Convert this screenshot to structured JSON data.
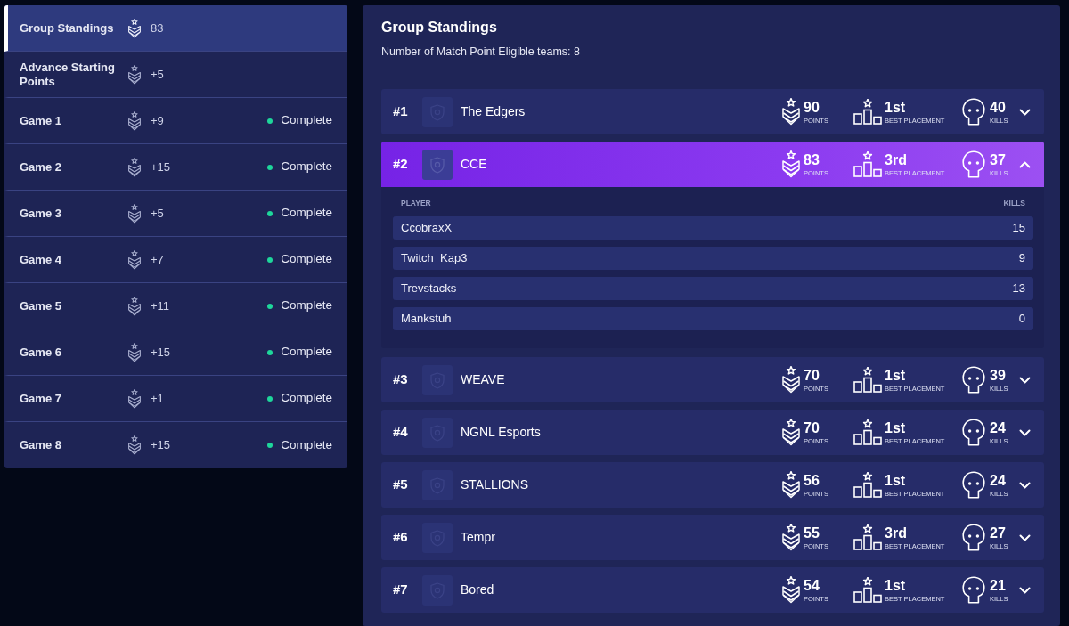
{
  "sidebar": {
    "items": [
      {
        "label": "Group Standings",
        "points": "83",
        "selected": true
      },
      {
        "label": "Advance Starting Points",
        "points": "+5",
        "selected": false
      },
      {
        "label": "Game 1",
        "points": "+9",
        "status": "Complete",
        "selected": false
      },
      {
        "label": "Game 2",
        "points": "+15",
        "status": "Complete",
        "selected": false
      },
      {
        "label": "Game 3",
        "points": "+5",
        "status": "Complete",
        "selected": false
      },
      {
        "label": "Game 4",
        "points": "+7",
        "status": "Complete",
        "selected": false
      },
      {
        "label": "Game 5",
        "points": "+11",
        "status": "Complete",
        "selected": false
      },
      {
        "label": "Game 6",
        "points": "+15",
        "status": "Complete",
        "selected": false
      },
      {
        "label": "Game 7",
        "points": "+1",
        "status": "Complete",
        "selected": false
      },
      {
        "label": "Game 8",
        "points": "+15",
        "status": "Complete",
        "selected": false
      }
    ]
  },
  "standings": {
    "title": "Group Standings",
    "subtitle": "Number of Match Point Eligible teams: 8",
    "teams": [
      {
        "rank": "#1",
        "name": "The Edgers",
        "points": "90",
        "points_label": "POINTS",
        "placement": "1st",
        "placement_label": "BEST PLACEMENT",
        "kills": "40",
        "kills_label": "KILLS",
        "expanded": false
      },
      {
        "rank": "#2",
        "name": "CCE",
        "points": "83",
        "points_label": "POINTS",
        "placement": "3rd",
        "placement_label": "BEST PLACEMENT",
        "kills": "37",
        "kills_label": "KILLS",
        "expanded": true,
        "player_header": "PLAYER",
        "kills_header": "KILLS",
        "players": [
          {
            "name": "CcobraxX",
            "kills": "15"
          },
          {
            "name": "Twitch_Kap3",
            "kills": "9"
          },
          {
            "name": "Trevstacks",
            "kills": "13"
          },
          {
            "name": "Mankstuh",
            "kills": "0"
          }
        ]
      },
      {
        "rank": "#3",
        "name": "WEAVE",
        "points": "70",
        "points_label": "POINTS",
        "placement": "1st",
        "placement_label": "BEST PLACEMENT",
        "kills": "39",
        "kills_label": "KILLS",
        "expanded": false
      },
      {
        "rank": "#4",
        "name": "NGNL Esports",
        "points": "70",
        "points_label": "POINTS",
        "placement": "1st",
        "placement_label": "BEST PLACEMENT",
        "kills": "24",
        "kills_label": "KILLS",
        "expanded": false
      },
      {
        "rank": "#5",
        "name": "STALLIONS",
        "points": "56",
        "points_label": "POINTS",
        "placement": "1st",
        "placement_label": "BEST PLACEMENT",
        "kills": "24",
        "kills_label": "KILLS",
        "expanded": false
      },
      {
        "rank": "#6",
        "name": "Tempr",
        "points": "55",
        "points_label": "POINTS",
        "placement": "3rd",
        "placement_label": "BEST PLACEMENT",
        "kills": "27",
        "kills_label": "KILLS",
        "expanded": false
      },
      {
        "rank": "#7",
        "name": "Bored",
        "points": "54",
        "points_label": "POINTS",
        "placement": "1st",
        "placement_label": "BEST PLACEMENT",
        "kills": "21",
        "kills_label": "KILLS",
        "expanded": false
      }
    ]
  }
}
